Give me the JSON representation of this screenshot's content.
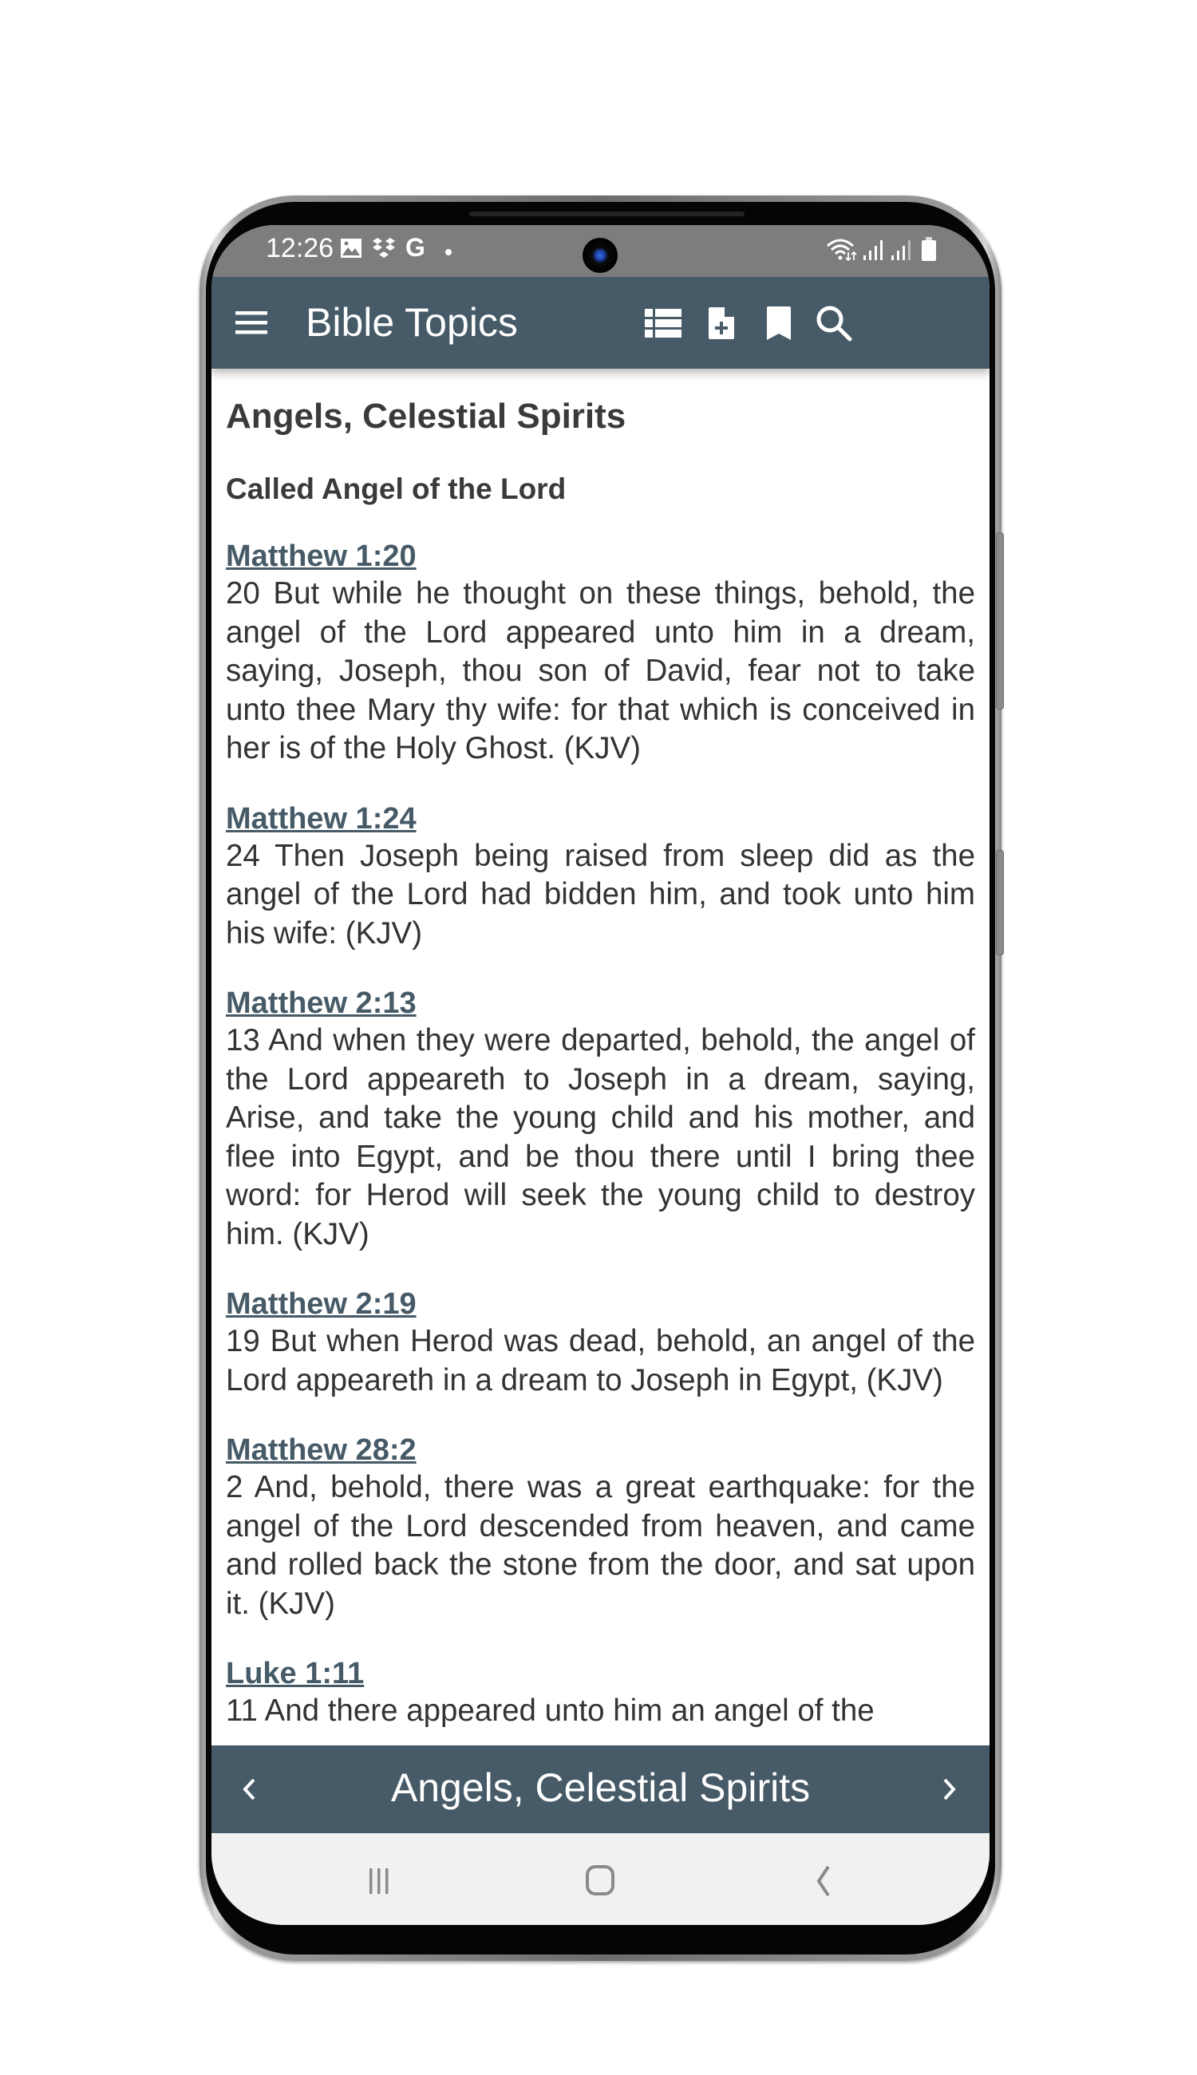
{
  "status_bar": {
    "time": "12:26",
    "left_icons": [
      "gallery-icon",
      "dropbox-icon",
      "google-icon",
      "dot-icon"
    ],
    "right_icons": [
      "wifi-icon",
      "signal-icon",
      "signal-icon",
      "battery-icon"
    ]
  },
  "app_bar": {
    "title": "Bible Topics",
    "actions": [
      "list-icon",
      "add-note-icon",
      "bookmark-icon",
      "search-icon"
    ]
  },
  "content": {
    "topic_title": "Angels, Celestial Spirits",
    "section_title": "Called Angel of the Lord",
    "entries": [
      {
        "ref": "Matthew 1:20",
        "text": "20 But while he thought on these things, behold, the angel of the Lord appeared unto him in a dream, saying, Joseph, thou son of David, fear not to take unto thee Mary thy wife: for that which is conceived in her is of the Holy Ghost. (KJV)"
      },
      {
        "ref": "Matthew 1:24",
        "text": "24 Then Joseph being raised from sleep did as the angel of the Lord had bidden him, and took unto him his wife: (KJV)"
      },
      {
        "ref": "Matthew 2:13",
        "text": "13 And when they were departed, behold, the angel of the Lord appeareth to Joseph in a dream, saying, Arise, and take the young child and his mother, and flee into Egypt, and be thou there until I bring thee word: for Herod will seek the young child to destroy him. (KJV)"
      },
      {
        "ref": "Matthew 2:19",
        "text": "19 But when Herod was dead, behold, an angel of the Lord appeareth in a dream to Joseph in Egypt, (KJV)"
      },
      {
        "ref": "Matthew 28:2",
        "text": "2 And, behold, there was a great earthquake: for the angel of the Lord descended from heaven, and came and rolled back the stone from the door, and sat upon it. (KJV)"
      },
      {
        "ref": "Luke 1:11",
        "text": "11 And there appeared unto him an angel of the"
      }
    ]
  },
  "bottom_bar": {
    "title": "Angels, Celestial Spirits",
    "prev_icon": "chevron-left-icon",
    "next_icon": "chevron-right-icon"
  },
  "nav_bar": {
    "buttons": [
      "recent-apps-icon",
      "home-icon",
      "back-icon"
    ]
  },
  "colors": {
    "app_bar": "#465a67",
    "link": "#465a67",
    "status_bar": "#7d7d7d",
    "nav_bar": "#f1f1f1",
    "text": "#333333"
  }
}
